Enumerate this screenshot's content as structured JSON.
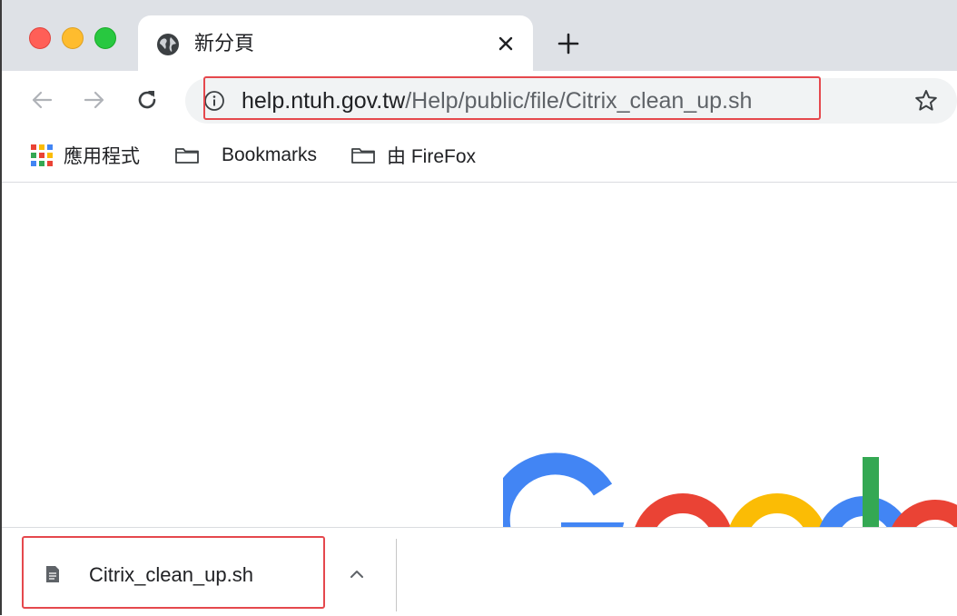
{
  "tab": {
    "title": "新分頁",
    "icon": "globe-icon",
    "close_icon": "close-icon"
  },
  "new_tab_icon": "plus-icon",
  "toolbar": {
    "back_icon": "back-arrow-icon",
    "forward_icon": "forward-arrow-icon",
    "reload_icon": "reload-icon",
    "bookmark_star_icon": "star-icon"
  },
  "omnibox": {
    "url_host": "help.ntuh.gov.tw",
    "url_path": "/Help/public/file/Citrix_clean_up.sh",
    "site_info_icon": "info-icon"
  },
  "bookmarks": {
    "items": [
      {
        "label": "應用程式",
        "icon": "apps-grid-icon"
      },
      {
        "label": "Bookmarks",
        "icon": "folder-icon"
      },
      {
        "label": "由 FireFox",
        "icon": "folder-icon"
      }
    ]
  },
  "download": {
    "filename": "Citrix_clean_up.sh",
    "file_icon": "file-icon",
    "menu_icon": "chevron-up-icon"
  },
  "colors": {
    "tabstrip_bg": "#dee1e6",
    "omnibox_bg": "#f1f3f4",
    "highlight": "#e5484d",
    "google_blue": "#4285f4",
    "google_red": "#ea4335",
    "google_yellow": "#fbbc05",
    "google_green": "#34a853"
  }
}
